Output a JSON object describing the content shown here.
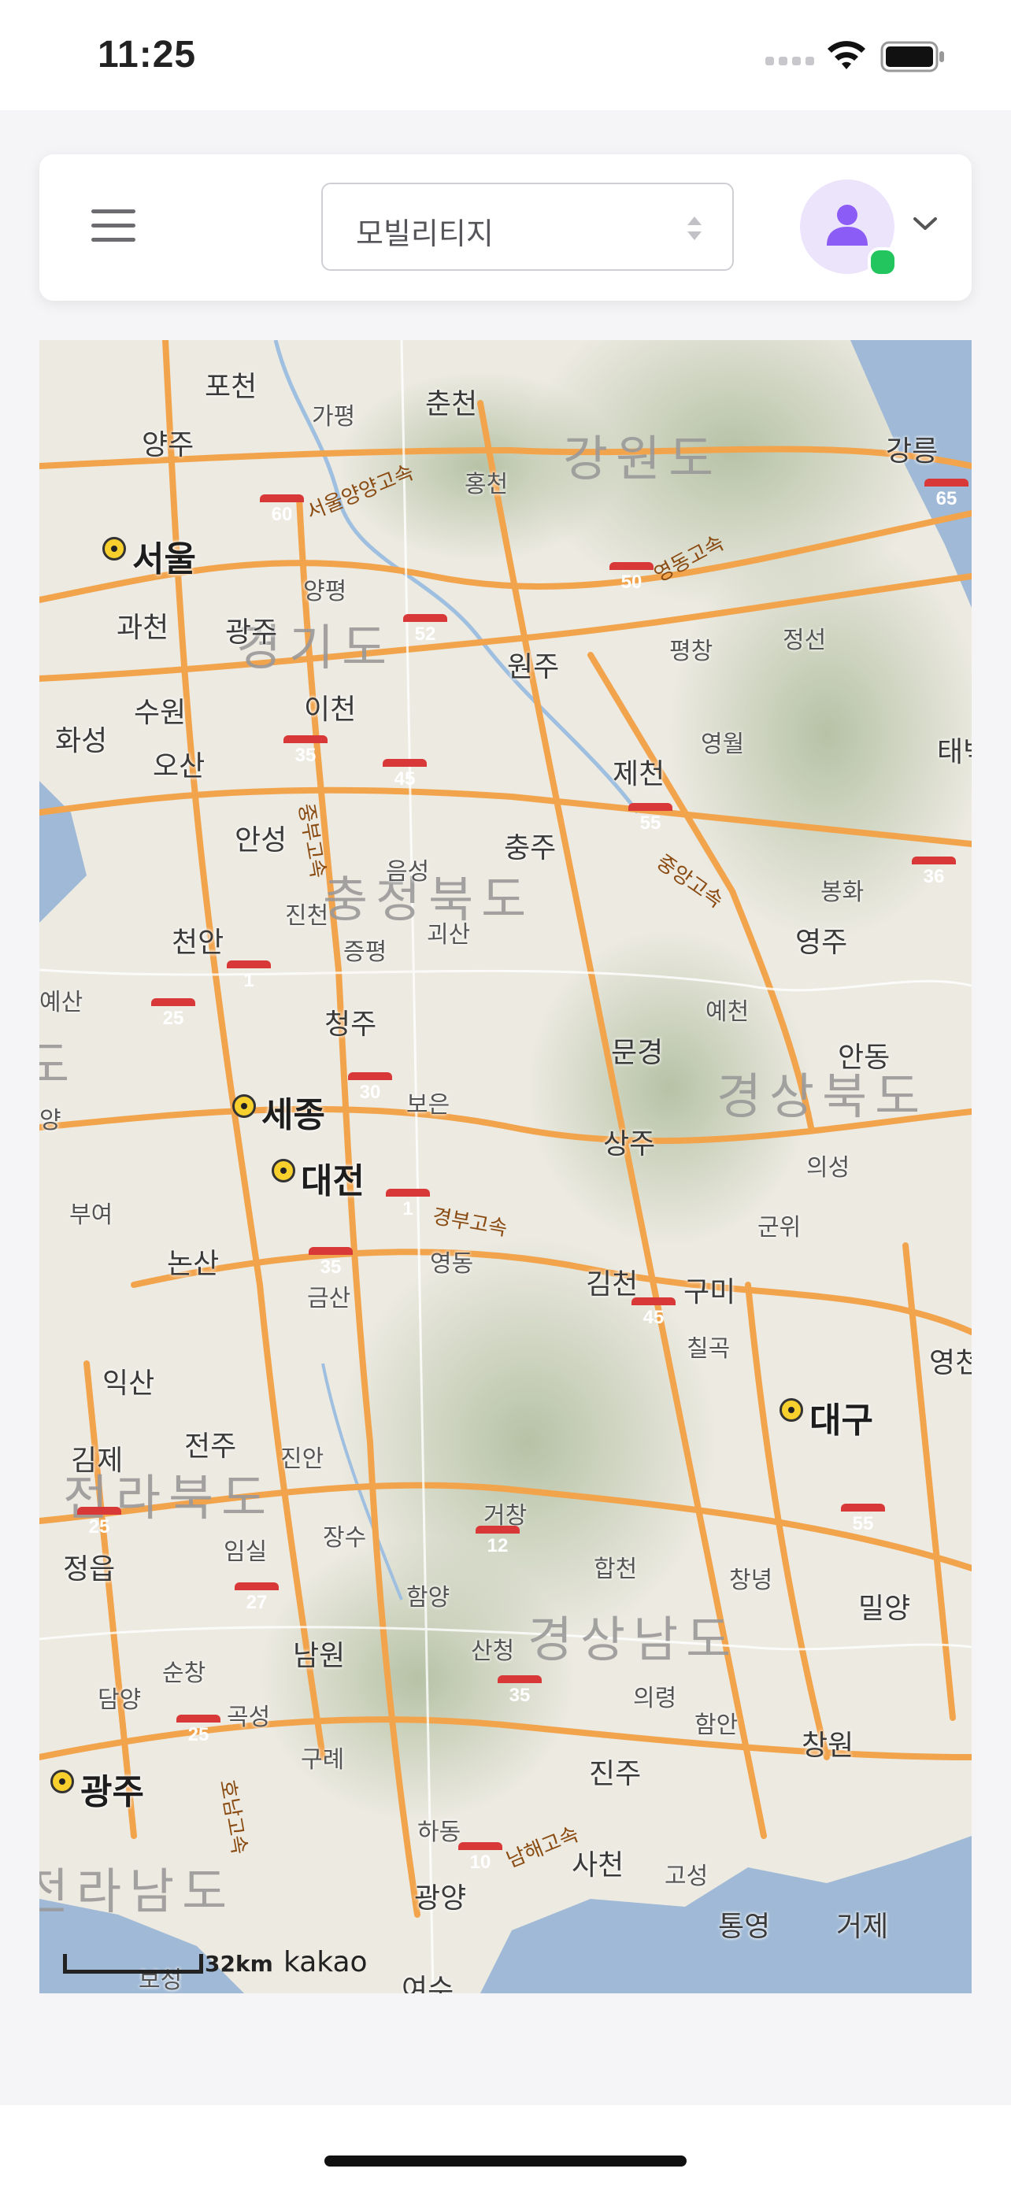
{
  "status_bar": {
    "time": "11:25"
  },
  "header": {
    "menu_icon": "hamburger-menu-icon",
    "select": {
      "value": "모빌리티지"
    },
    "avatar_icon": "user-icon",
    "dropdown_icon": "chevron-down-icon"
  },
  "map": {
    "cities": [
      "서울",
      "세종",
      "대전",
      "대구",
      "광주"
    ],
    "provinces": [
      "강원도",
      "경기도",
      "충청북도",
      "충청남도",
      "경상북도",
      "전라북도",
      "경상남도",
      "전라남도"
    ],
    "places": [
      "포천",
      "가평",
      "춘천",
      "양주",
      "홍천",
      "강릉",
      "양평",
      "과천",
      "광주",
      "원주",
      "평창",
      "정선",
      "이천",
      "수원",
      "화성",
      "오산",
      "영월",
      "제천",
      "태백",
      "안성",
      "충주",
      "음성",
      "진천",
      "괴산",
      "봉화",
      "증평",
      "영주",
      "천안",
      "예산",
      "청주",
      "예천",
      "문경",
      "안동",
      "보은",
      "상주",
      "의성",
      "부여",
      "군위",
      "논산",
      "영동",
      "김천",
      "구미",
      "금산",
      "칠곡",
      "익산",
      "영천",
      "김제",
      "전주",
      "진안",
      "거창",
      "장수",
      "임실",
      "정읍",
      "합천",
      "창녕",
      "밀양",
      "함양",
      "남원",
      "산청",
      "순창",
      "담양",
      "곡성",
      "의령",
      "함안",
      "창원",
      "구례",
      "진주",
      "하동",
      "사천",
      "고성",
      "광양",
      "통영",
      "거제",
      "보성",
      "여수",
      "양"
    ],
    "highways": [
      {
        "num": "60",
        "name": "서울양양고속"
      },
      {
        "num": "50",
        "name": "영동고속"
      },
      {
        "num": "52"
      },
      {
        "num": "65"
      },
      {
        "num": "35",
        "name": "중부고속"
      },
      {
        "num": "45"
      },
      {
        "num": "55",
        "name": "중앙고속"
      },
      {
        "num": "36"
      },
      {
        "num": "1"
      },
      {
        "num": "25"
      },
      {
        "num": "30"
      },
      {
        "num": "1",
        "name": "경부고속"
      },
      {
        "num": "35"
      },
      {
        "num": "45"
      },
      {
        "num": "55"
      },
      {
        "num": "25"
      },
      {
        "num": "27"
      },
      {
        "num": "12"
      },
      {
        "num": "35"
      },
      {
        "num": "25",
        "name": "호남고속"
      },
      {
        "num": "10",
        "name": "남해고속"
      }
    ],
    "scale_label": "32km",
    "attribution": "kakao"
  }
}
